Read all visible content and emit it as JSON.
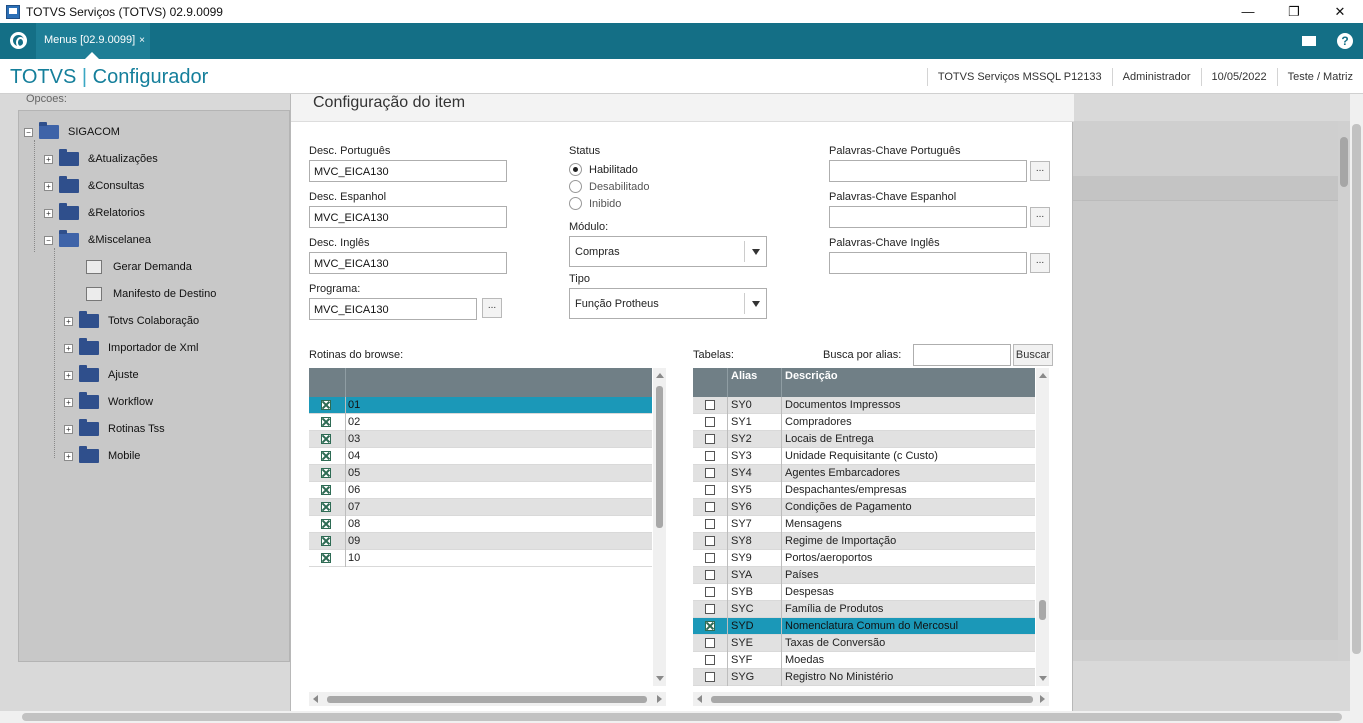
{
  "window": {
    "title": "TOTVS Serviços (TOTVS) 02.9.0099",
    "controls": [
      "—",
      "❐",
      "✕"
    ]
  },
  "tabbar": {
    "tab_label": "Menus [02.9.0099]",
    "tab_close": "×",
    "help_glyph": "?"
  },
  "header": {
    "brand_left": "TOTVS",
    "brand_sep": "|",
    "brand_right": "Configurador",
    "environment": "TOTVS Serviços MSSQL P12133",
    "user": "Administrador",
    "date": "10/05/2022",
    "branch": "Teste / Matriz"
  },
  "tree": {
    "caption": "Opcoes:",
    "items": [
      {
        "label": "SIGACOM",
        "exp": "−"
      },
      {
        "label": "&Atualizações",
        "exp": "+"
      },
      {
        "label": "&Consultas",
        "exp": "+"
      },
      {
        "label": "&Relatorios",
        "exp": "+"
      },
      {
        "label": "&Miscelanea",
        "exp": "−"
      },
      {
        "label": "Gerar Demanda"
      },
      {
        "label": "Manifesto de Destino"
      },
      {
        "label": "Totvs Colaboração",
        "exp": "+"
      },
      {
        "label": "Importador de Xml",
        "exp": "+"
      },
      {
        "label": "Ajuste",
        "exp": "+"
      },
      {
        "label": "Workflow",
        "exp": "+"
      },
      {
        "label": "Rotinas Tss",
        "exp": "+"
      },
      {
        "label": "Mobile",
        "exp": "+"
      }
    ]
  },
  "dialog": {
    "title": "Configuração do item",
    "desc_pt_label": "Desc. Português",
    "desc_pt_value": "MVC_EICA130",
    "desc_es_label": "Desc. Espanhol",
    "desc_es_value": "MVC_EICA130",
    "desc_en_label": "Desc. Inglês",
    "desc_en_value": "MVC_EICA130",
    "programa_label": "Programa:",
    "programa_value": "MVC_EICA130",
    "ellipsis": "...",
    "status_label": "Status",
    "status_options": [
      "Habilitado",
      "Desabilitado",
      "Inibido"
    ],
    "status_selected": "Habilitado",
    "modulo_label": "Módulo:",
    "modulo_value": "Compras",
    "tipo_label": "Tipo",
    "tipo_value": "Função Protheus",
    "kw_pt_label": "Palavras-Chave Português",
    "kw_es_label": "Palavras-Chave Espanhol",
    "kw_en_label": "Palavras-Chave Inglês",
    "rotinas_label": "Rotinas do browse:",
    "tabelas_label": "Tabelas:",
    "busca_label": "Busca por alias:",
    "busca_value": "",
    "buscar_button": "Buscar"
  },
  "rotinas_grid": {
    "rows": [
      {
        "value": "01",
        "checked": true,
        "selected": true
      },
      {
        "value": "02",
        "checked": true
      },
      {
        "value": "03",
        "checked": true
      },
      {
        "value": "04",
        "checked": true
      },
      {
        "value": "05",
        "checked": true
      },
      {
        "value": "06",
        "checked": true
      },
      {
        "value": "07",
        "checked": true
      },
      {
        "value": "08",
        "checked": true
      },
      {
        "value": "09",
        "checked": true
      },
      {
        "value": "10",
        "checked": true
      }
    ]
  },
  "tabelas_grid": {
    "columns": [
      "Alias",
      "Descrição"
    ],
    "rows": [
      {
        "alias": "SY0",
        "desc": "Documentos Impressos",
        "checked": false
      },
      {
        "alias": "SY1",
        "desc": "Compradores",
        "checked": false
      },
      {
        "alias": "SY2",
        "desc": "Locais de Entrega",
        "checked": false
      },
      {
        "alias": "SY3",
        "desc": "Unidade Requisitante (c Custo)",
        "checked": false
      },
      {
        "alias": "SY4",
        "desc": "Agentes Embarcadores",
        "checked": false
      },
      {
        "alias": "SY5",
        "desc": "Despachantes/empresas",
        "checked": false
      },
      {
        "alias": "SY6",
        "desc": "Condições de Pagamento",
        "checked": false
      },
      {
        "alias": "SY7",
        "desc": "Mensagens",
        "checked": false
      },
      {
        "alias": "SY8",
        "desc": "Regime de Importação",
        "checked": false
      },
      {
        "alias": "SY9",
        "desc": "Portos/aeroportos",
        "checked": false
      },
      {
        "alias": "SYA",
        "desc": "Países",
        "checked": false
      },
      {
        "alias": "SYB",
        "desc": "Despesas",
        "checked": false
      },
      {
        "alias": "SYC",
        "desc": "Família de Produtos",
        "checked": false
      },
      {
        "alias": "SYD",
        "desc": "Nomenclatura Comum do Mercosul",
        "checked": true,
        "selected": true
      },
      {
        "alias": "SYE",
        "desc": "Taxas de Conversão",
        "checked": false
      },
      {
        "alias": "SYF",
        "desc": "Moedas",
        "checked": false
      },
      {
        "alias": "SYG",
        "desc": "Registro No Ministério",
        "checked": false
      }
    ]
  },
  "colors": {
    "accent": "#146f86",
    "selection": "#1b98b8",
    "grid_header": "#707f86"
  }
}
